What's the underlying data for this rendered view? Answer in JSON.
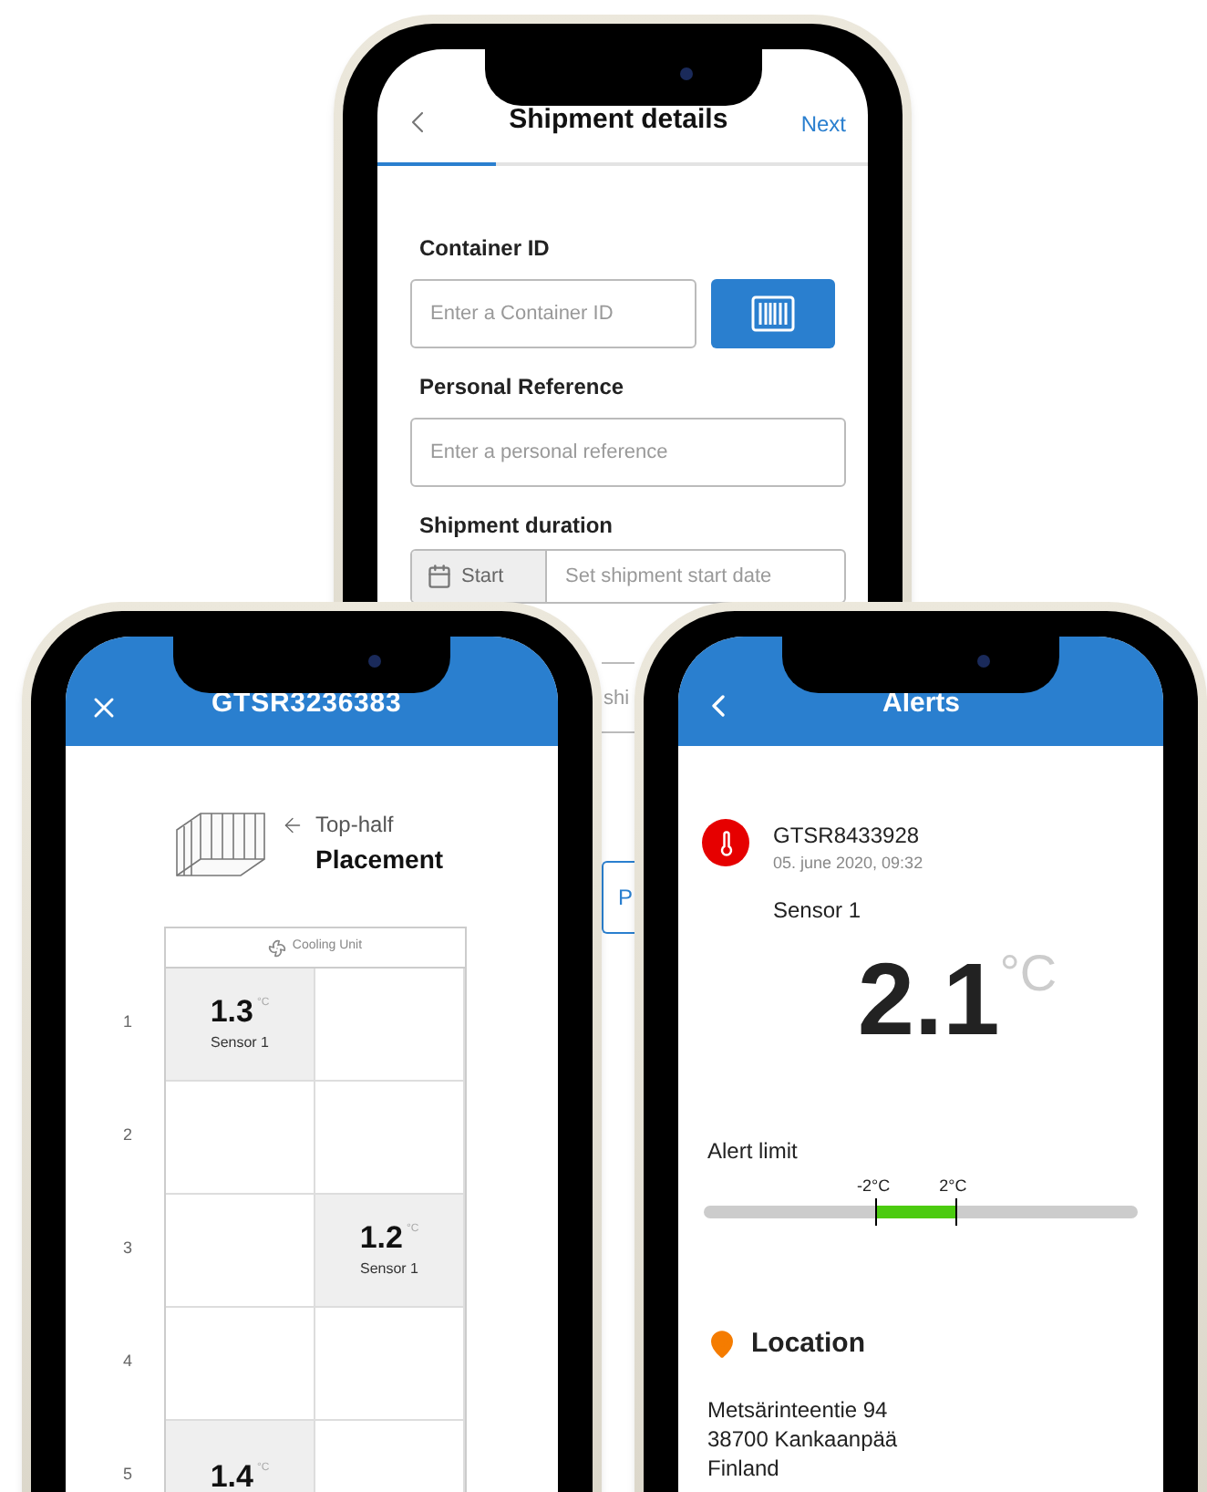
{
  "back_screen": {
    "title": "Shipment details",
    "next": "Next",
    "progress": {
      "level": 0.24
    },
    "container_id": {
      "label": "Container ID",
      "placeholder": "Enter a Container ID"
    },
    "personal_reference": {
      "label": "Personal Reference",
      "placeholder": "Enter a personal reference"
    },
    "shipment_duration": {
      "label": "Shipment duration",
      "start_label": "Start",
      "start_placeholder": "Set shipment start date",
      "field_2_placeholder": "shi"
    },
    "button_partial": "P"
  },
  "left_screen": {
    "title": "GTSR3236383",
    "position_hint": "Top-half",
    "heading": "Placement",
    "cooling_unit": "Cooling Unit",
    "rows": [
      {
        "number": "1",
        "cells": [
          {
            "kind": "sensor",
            "value": "1.3",
            "unit": "°C",
            "label": "Sensor 1"
          },
          {
            "kind": "empty"
          }
        ]
      },
      {
        "number": "2",
        "cells": [
          {
            "kind": "empty"
          },
          {
            "kind": "empty"
          }
        ]
      },
      {
        "number": "3",
        "cells": [
          {
            "kind": "empty"
          },
          {
            "kind": "sensor",
            "value": "1.2",
            "unit": "°C",
            "label": "Sensor 1"
          }
        ]
      },
      {
        "number": "4",
        "cells": [
          {
            "kind": "empty"
          },
          {
            "kind": "empty"
          }
        ]
      },
      {
        "number": "5",
        "cells": [
          {
            "kind": "sensor",
            "value": "1.4",
            "unit": "°C"
          },
          {
            "kind": "empty"
          }
        ]
      }
    ]
  },
  "right_screen": {
    "title": "Alerts",
    "alert": {
      "id": "GTSR8433928",
      "time": "05. june 2020, 09:32",
      "sensor": "Sensor 1",
      "value": "2.1",
      "unit": "°C"
    },
    "alert_limit": {
      "label": "Alert limit",
      "low": "-2°C",
      "high": "2°C"
    },
    "location": {
      "title": "Location",
      "lines": [
        "Metsärinteentie 94",
        "38700 Kankaanpää",
        "Finland"
      ]
    }
  }
}
